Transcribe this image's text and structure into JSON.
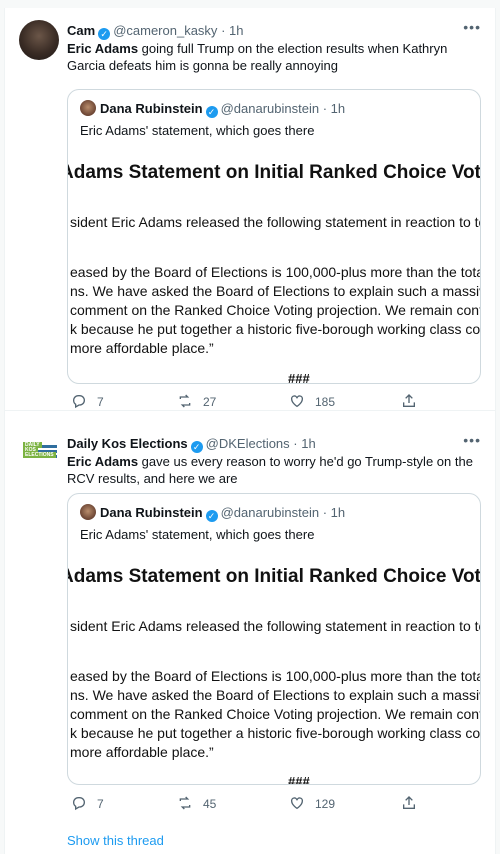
{
  "tweets": [
    {
      "name": "Cam",
      "handle": "@cameron_kasky",
      "time": "1h",
      "text_bold": "Eric Adams",
      "text_rest": " going full Trump on the election results when Kathryn Garcia defeats him is gonna be really annoying",
      "avatar_icon": "user-photo",
      "quote": {
        "name": "Dana Rubinstein",
        "handle": "@danarubinstein",
        "time": "1h",
        "text": "Eric Adams' statement, which goes there",
        "doc_title": "Adams Statement on Initial Ranked Choice Voting",
        "doc_line1": "sident Eric Adams released the following statement in reaction to toda",
        "doc_line2": "eased by the Board of Elections is 100,000-plus more than the total ar",
        "doc_line3": "ns. We have asked the Board of Elections to explain such a massive",
        "doc_line4": "comment on the Ranked Choice Voting projection. We remain confid",
        "doc_line5": "k because he put together a historic five-borough working class coalit",
        "doc_line6": "more affordable place.”",
        "doc_hash": "###"
      },
      "replies": "7",
      "retweets": "27",
      "likes": "185"
    },
    {
      "name": "Daily Kos Elections",
      "handle": "@DKElections",
      "time": "1h",
      "text_bold": "Eric Adams",
      "text_rest": " gave us every reason to worry he'd go Trump-style on the RCV results, and here we are",
      "avatar_icon": "daily-kos-logo",
      "logo_words": [
        "DAILY",
        "KOS",
        "ELECTIONS"
      ],
      "quote": {
        "name": "Dana Rubinstein",
        "handle": "@danarubinstein",
        "time": "1h",
        "text": "Eric Adams' statement, which goes there",
        "doc_title": "Adams Statement on Initial Ranked Choice Voting",
        "doc_line1": "sident Eric Adams released the following statement in reaction to toda",
        "doc_line2": "eased by the Board of Elections is 100,000-plus more than the total ar",
        "doc_line3": "ns. We have asked the Board of Elections to explain such a massive",
        "doc_line4": "comment on the Ranked Choice Voting projection. We remain confid",
        "doc_line5": "k because he put together a historic five-borough working class coalit",
        "doc_line6": "more affordable place.”",
        "doc_hash": "###"
      },
      "replies": "7",
      "retweets": "45",
      "likes": "129"
    }
  ],
  "show_thread": "Show this thread",
  "colors": {
    "accent": "#1d9bf0",
    "muted": "#536471",
    "border": "#cfd9de"
  }
}
